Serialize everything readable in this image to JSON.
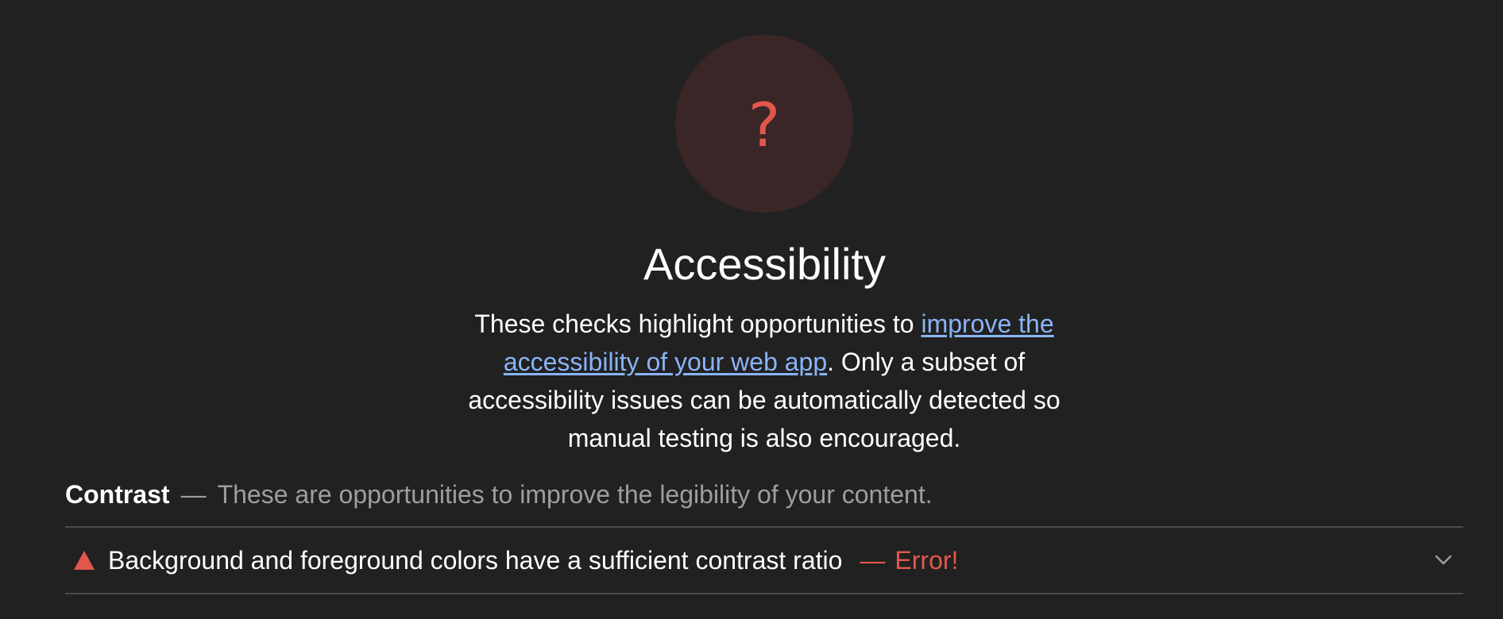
{
  "category": {
    "score_text": "?",
    "title": "Accessibility",
    "description": {
      "prefix": "These checks highlight opportunities to ",
      "link_text": "improve the accessibility of your web app",
      "suffix": ". Only a subset of accessibility issues can be automatically detected so manual testing is also encouraged."
    }
  },
  "group": {
    "title": "Contrast",
    "separator": "—",
    "description": "These are opportunities to improve the legibility of your content."
  },
  "audit": {
    "icon": "fail-triangle-icon",
    "title": "Background and foreground colors have a sufficient contrast ratio",
    "separator": "—",
    "error_text": "Error!"
  },
  "colors": {
    "background": "#212121",
    "error": "#e2574c",
    "link": "#8ab4f8",
    "gauge_fill": "#3a2626",
    "muted_text": "#9e9e9e"
  }
}
